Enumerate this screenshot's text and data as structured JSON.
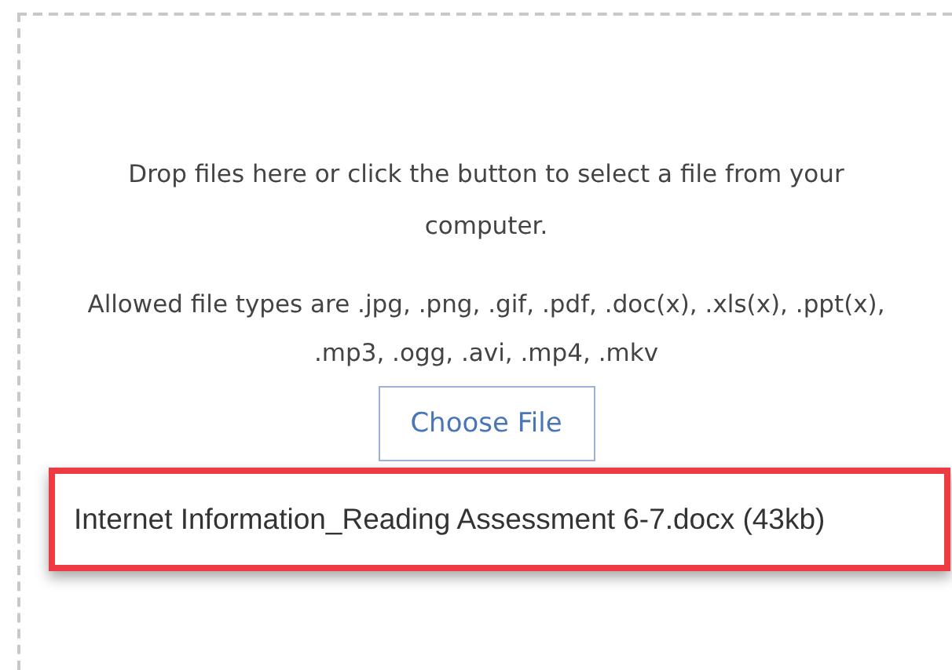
{
  "dropzone": {
    "instructions": "Drop files here or click the button to select a file from your computer.",
    "allowed_types": "Allowed file types are .jpg, .png, .gif, .pdf, .doc(x), .xls(x), .ppt(x), .mp3, .ogg, .avi, .mp4, .mkv",
    "button": "Choose File",
    "file": {
      "name": "Internet Information_Reading Assessment 6-7.docx (43kb)",
      "highlighted": true
    }
  }
}
